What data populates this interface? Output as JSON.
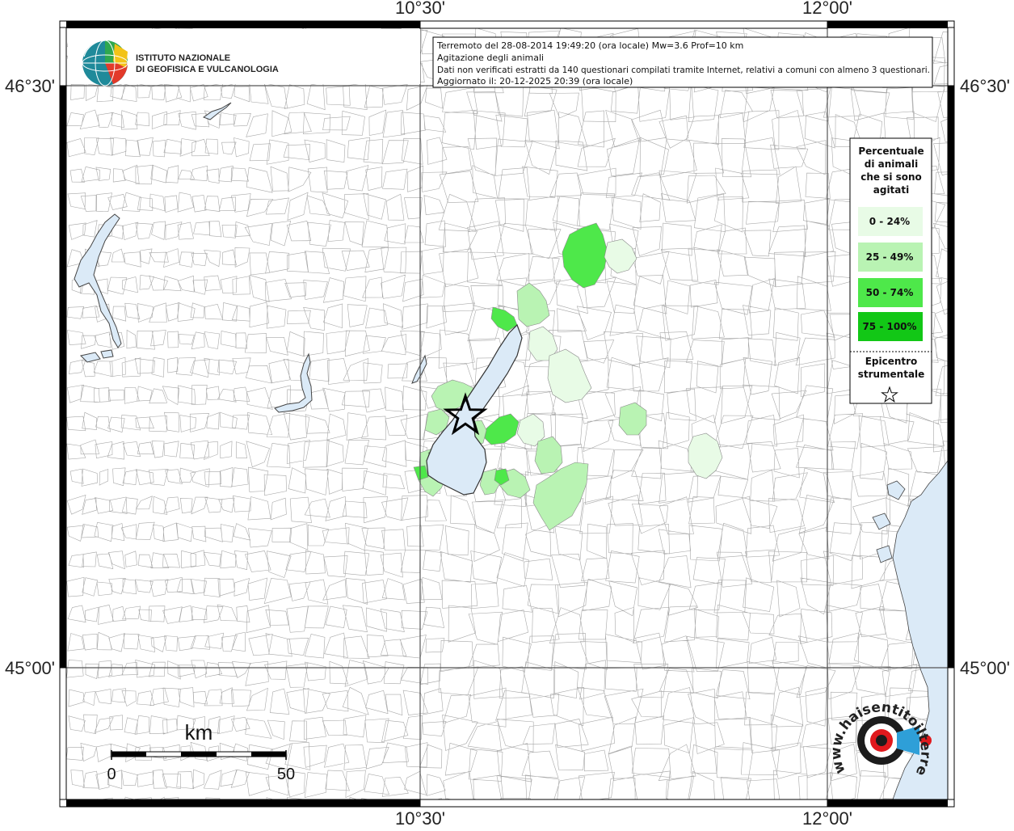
{
  "map": {
    "coords": {
      "top_left": "10°30'",
      "top_right": "12°00'",
      "bottom_left": "10°30'",
      "bottom_right": "12°00'",
      "left_top": "46°30'",
      "left_bottom": "45°00'",
      "right_top": "46°30'",
      "right_bottom": "45°00'"
    },
    "institute": {
      "line1": "ISTITUTO NAZIONALE",
      "line2": "DI GEOFISICA E VULCANOLOGIA"
    },
    "info": {
      "line1": "Terremoto del 28-08-2014 19:49:20 (ora locale) Mw=3.6 Prof=10 km",
      "line2": "Agitazione degli animali",
      "line3": "Dati non verificati estratti da 140 questionari compilati tramite Internet, relativi a comuni con almeno 3 questionari.",
      "line4": "Aggiornato il: 20-12-2025 20:39 (ora locale)"
    },
    "legend": {
      "title": [
        "Percentuale",
        "di animali",
        "che si sono",
        "agitati"
      ],
      "items": [
        {
          "label": "0 - 24%",
          "color": "#e8fbe6"
        },
        {
          "label": "25 - 49%",
          "color": "#b9f3b3"
        },
        {
          "label": "50 - 74%",
          "color": "#4ee84a"
        },
        {
          "label": "75 - 100%",
          "color": "#12c716"
        }
      ],
      "epicenter_line1": "Epicentro",
      "epicenter_line2": "strumentale",
      "epicenter_icon": "star-outline-icon"
    },
    "scale": {
      "unit": "km",
      "start": "0",
      "end": "50"
    },
    "watermark": {
      "text": "www.haisentitoilterremoto.it",
      "icon": "megaphone-target-icon"
    },
    "colors": {
      "water": "#dbeaf7",
      "border": "#9a9a9a",
      "frame": "#000000"
    }
  }
}
